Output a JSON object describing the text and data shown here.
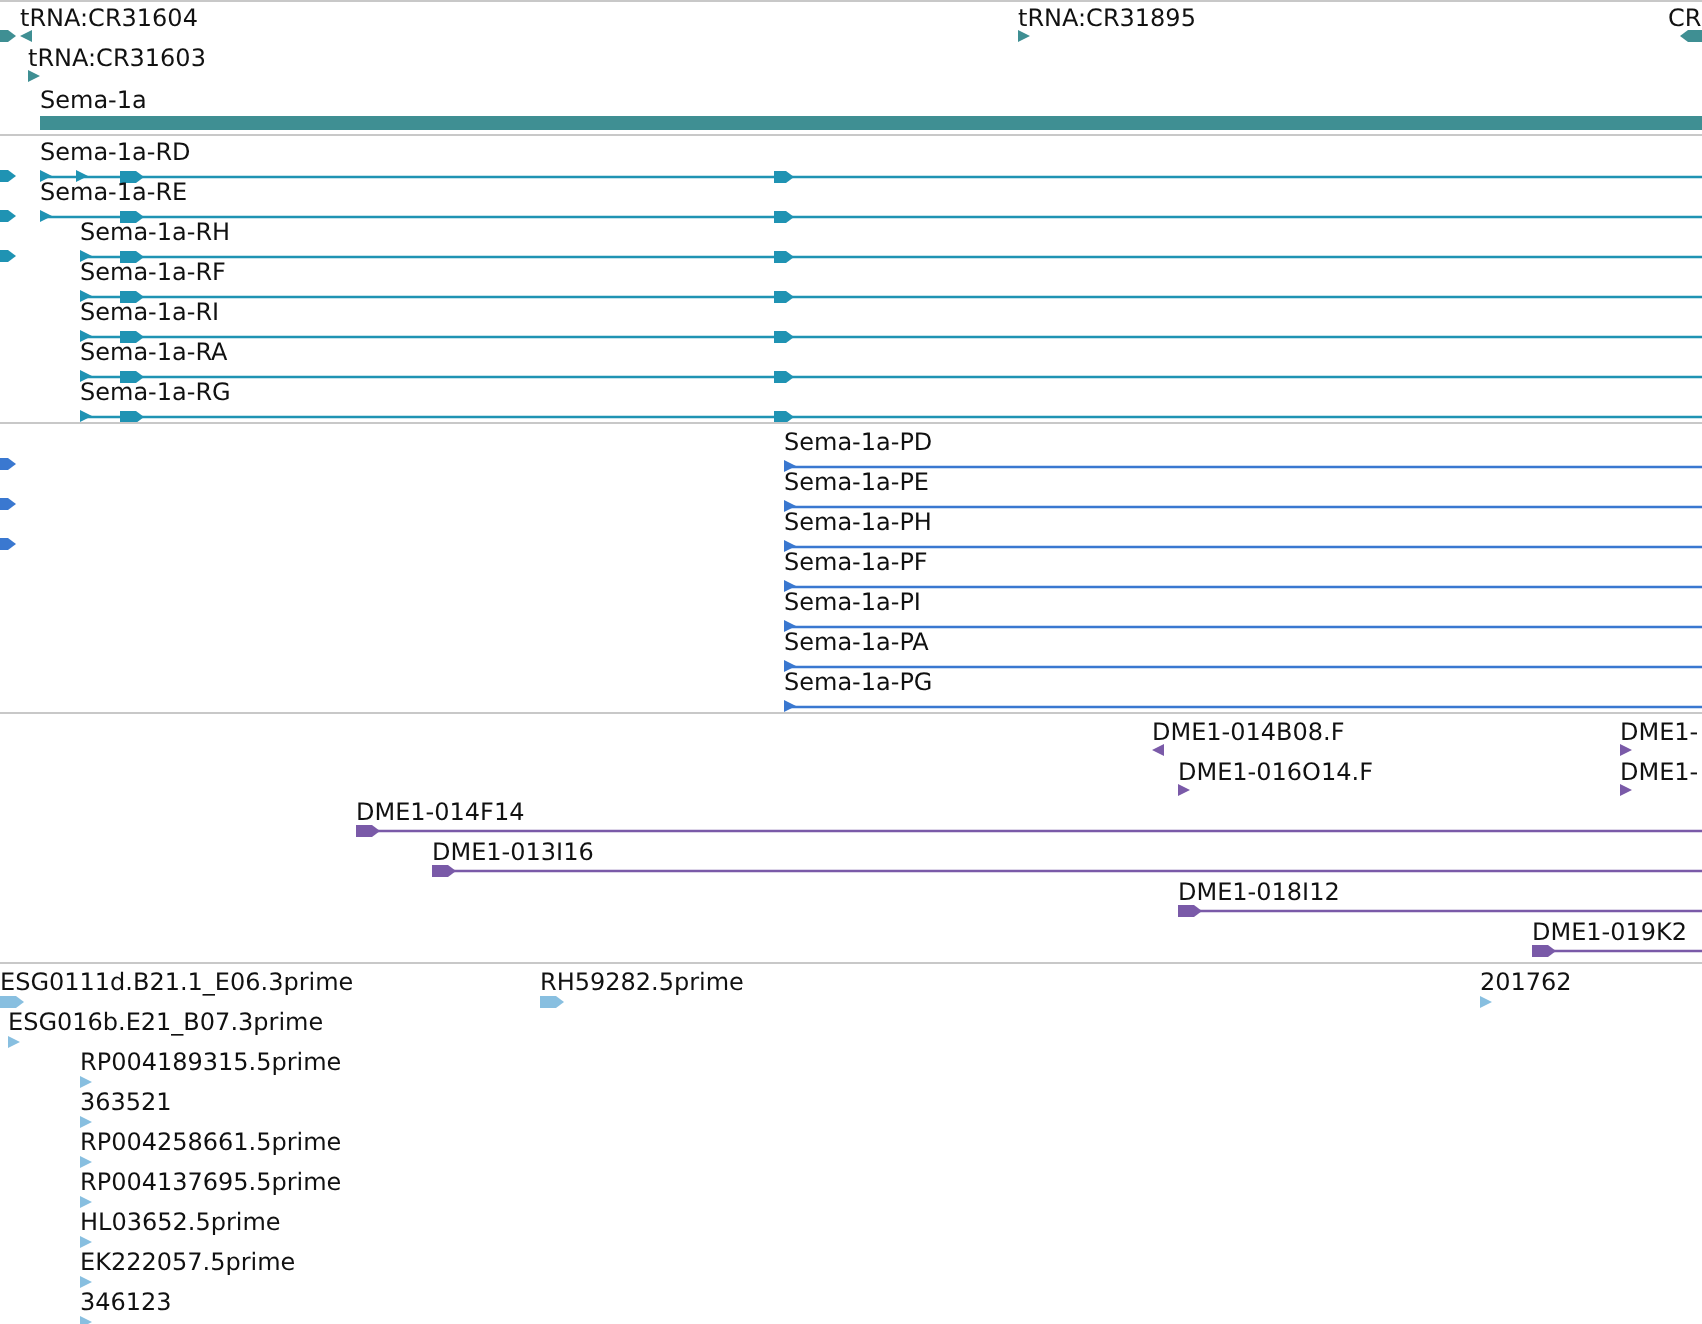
{
  "tracks": [
    {
      "color": "#3f8f93",
      "features": [
        {
          "label": "tRNA:CR31604",
          "kind": "marker",
          "reverse": true
        },
        {
          "label": "tRNA:CR31603",
          "kind": "marker",
          "reverse": false
        },
        {
          "label": "Sema-1a",
          "kind": "gene",
          "reverse": false
        },
        {
          "label": "tRNA:CR31895",
          "kind": "marker",
          "reverse": false
        },
        {
          "label": "CR",
          "kind": "marker",
          "reverse": true
        }
      ]
    },
    {
      "color": "#1f93b3",
      "features": [
        {
          "label": "Sema-1a-RD",
          "kind": "transcript",
          "reverse": false
        },
        {
          "label": "Sema-1a-RE",
          "kind": "transcript",
          "reverse": false
        },
        {
          "label": "Sema-1a-RH",
          "kind": "transcript",
          "reverse": false
        },
        {
          "label": "Sema-1a-RF",
          "kind": "transcript",
          "reverse": false
        },
        {
          "label": "Sema-1a-RI",
          "kind": "transcript",
          "reverse": false
        },
        {
          "label": "Sema-1a-RA",
          "kind": "transcript",
          "reverse": false
        },
        {
          "label": "Sema-1a-RG",
          "kind": "transcript",
          "reverse": false
        }
      ]
    },
    {
      "color": "#3a78d0",
      "features": [
        {
          "label": "Sema-1a-PD",
          "kind": "transcript",
          "reverse": false
        },
        {
          "label": "Sema-1a-PE",
          "kind": "transcript",
          "reverse": false
        },
        {
          "label": "Sema-1a-PH",
          "kind": "transcript",
          "reverse": false
        },
        {
          "label": "Sema-1a-PF",
          "kind": "transcript",
          "reverse": false
        },
        {
          "label": "Sema-1a-PI",
          "kind": "transcript",
          "reverse": false
        },
        {
          "label": "Sema-1a-PA",
          "kind": "transcript",
          "reverse": false
        },
        {
          "label": "Sema-1a-PG",
          "kind": "transcript",
          "reverse": false
        }
      ]
    },
    {
      "color": "#7a5aa8",
      "features": [
        {
          "label": "DME1-014B08.F",
          "kind": "marker",
          "reverse": true
        },
        {
          "label": "DME1-016O14.F",
          "kind": "marker",
          "reverse": false
        },
        {
          "label": "DME1-",
          "kind": "marker",
          "reverse": false
        },
        {
          "label": "DME1-",
          "kind": "marker",
          "reverse": false
        },
        {
          "label": "DME1-014F14",
          "kind": "clone",
          "reverse": false
        },
        {
          "label": "DME1-013I16",
          "kind": "clone",
          "reverse": false
        },
        {
          "label": "DME1-018I12",
          "kind": "clone",
          "reverse": false
        },
        {
          "label": "DME1-019K2",
          "kind": "clone",
          "reverse": false
        }
      ]
    },
    {
      "color": "#88bfe0",
      "features": [
        {
          "label": "ESG0111d.B21.1_E06.3prime",
          "kind": "marker",
          "reverse": false
        },
        {
          "label": "RH59282.5prime",
          "kind": "marker",
          "reverse": false
        },
        {
          "label": "201762",
          "kind": "marker",
          "reverse": false
        },
        {
          "label": "ESG016b.E21_B07.3prime",
          "kind": "marker",
          "reverse": false
        },
        {
          "label": "RP004189315.5prime",
          "kind": "marker",
          "reverse": false
        },
        {
          "label": "363521",
          "kind": "marker",
          "reverse": false
        },
        {
          "label": "RP004258661.5prime",
          "kind": "marker",
          "reverse": false
        },
        {
          "label": "RP004137695.5prime",
          "kind": "marker",
          "reverse": false
        },
        {
          "label": "HL03652.5prime",
          "kind": "marker",
          "reverse": false
        },
        {
          "label": "EK222057.5prime",
          "kind": "marker",
          "reverse": false
        },
        {
          "label": "346123",
          "kind": "marker",
          "reverse": false
        }
      ]
    }
  ]
}
